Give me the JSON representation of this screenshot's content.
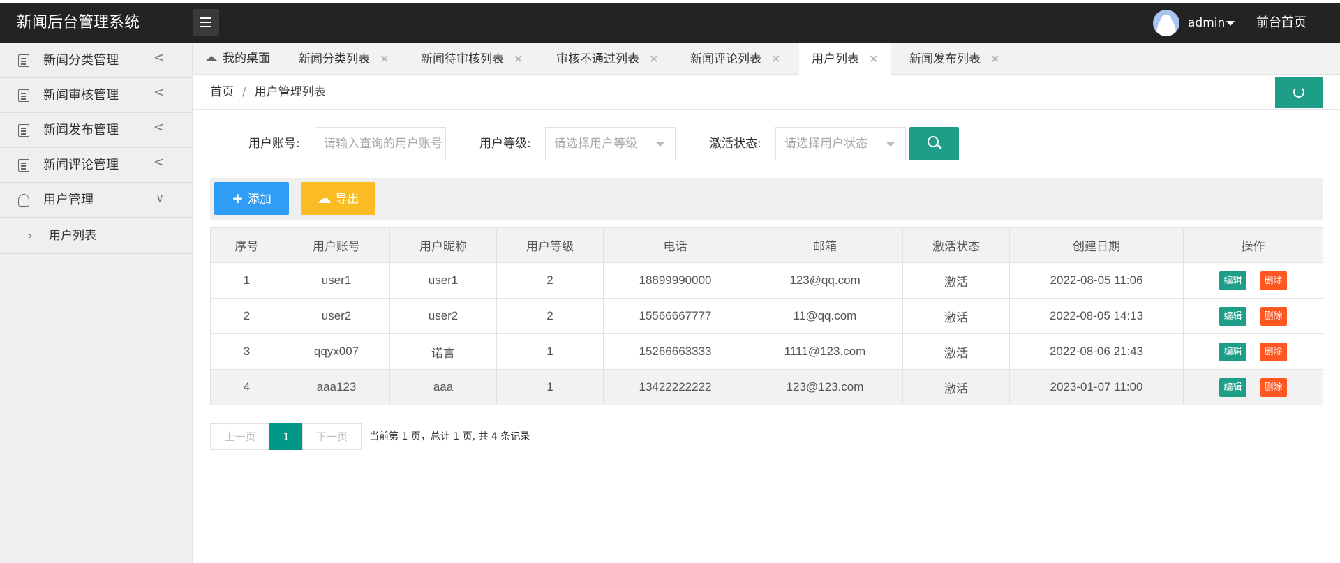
{
  "app": {
    "title": "新闻后台管理系统",
    "user": "admin",
    "front_link": "前台首页"
  },
  "sidebar": {
    "items": [
      {
        "label": "新闻分类管理",
        "arrow": "<"
      },
      {
        "label": "新闻审核管理",
        "arrow": "<"
      },
      {
        "label": "新闻发布管理",
        "arrow": "<"
      },
      {
        "label": "新闻评论管理",
        "arrow": "<"
      },
      {
        "label": "用户管理",
        "arrow": "∨"
      }
    ],
    "sub_items": [
      {
        "label": "用户列表",
        "chevron": "›"
      }
    ]
  },
  "tabs": [
    {
      "label": "我的桌面",
      "closable": false
    },
    {
      "label": "新闻分类列表",
      "closable": true
    },
    {
      "label": "新闻待审核列表",
      "closable": true
    },
    {
      "label": "审核不通过列表",
      "closable": true
    },
    {
      "label": "新闻评论列表",
      "closable": true
    },
    {
      "label": "用户列表",
      "closable": true,
      "active": true
    },
    {
      "label": "新闻发布列表",
      "closable": true
    }
  ],
  "close_glyph": "✕",
  "breadcrumb": {
    "home": "首页",
    "separator": "/",
    "current": "用户管理列表"
  },
  "search": {
    "account_label": "用户账号:",
    "account_placeholder": "请输入查询的用户账号",
    "level_label": "用户等级:",
    "level_placeholder": "请选择用户等级",
    "status_label": "激活状态:",
    "status_placeholder": "请选择用户状态"
  },
  "toolbar": {
    "add_glyph": "+",
    "add_label": "添加",
    "export_glyph": "☁",
    "export_label": "导出"
  },
  "table": {
    "headers": [
      "序号",
      "用户账号",
      "用户昵称",
      "用户等级",
      "电话",
      "邮箱",
      "激活状态",
      "创建日期",
      "操作"
    ],
    "rows": [
      {
        "cells": [
          "1",
          "user1",
          "user1",
          "2",
          "18899990000",
          "123@qq.com",
          "激活",
          "2022-08-05 11:06"
        ]
      },
      {
        "cells": [
          "2",
          "user2",
          "user2",
          "2",
          "15566667777",
          "11@qq.com",
          "激活",
          "2022-08-05 14:13"
        ]
      },
      {
        "cells": [
          "3",
          "qqyx007",
          "诺言",
          "1",
          "15266663333",
          "1111@123.com",
          "激活",
          "2022-08-06 21:43"
        ]
      },
      {
        "cells": [
          "4",
          "aaa123",
          "aaa",
          "1",
          "13422222222",
          "123@123.com",
          "激活",
          "2023-01-07 11:00"
        ]
      }
    ],
    "edit_label": "编辑",
    "delete_label": "删除"
  },
  "pagination": {
    "prev": "上一页",
    "current": "1",
    "next": "下一页",
    "info": "当前第 1 页，总计 1 页, 共 4 条记录"
  },
  "colors": {
    "header_bg": "#232323",
    "accent_teal": "#1e9e89",
    "add_blue": "#2f9cf5",
    "export_yellow": "#fbbb22",
    "delete_orange": "#ff5722"
  },
  "icons": {
    "menu": "hamburger-icon",
    "home": "home-icon",
    "refresh": "refresh-icon",
    "search": "search-icon",
    "add": "plus-icon",
    "export": "cloud-upload-icon"
  }
}
